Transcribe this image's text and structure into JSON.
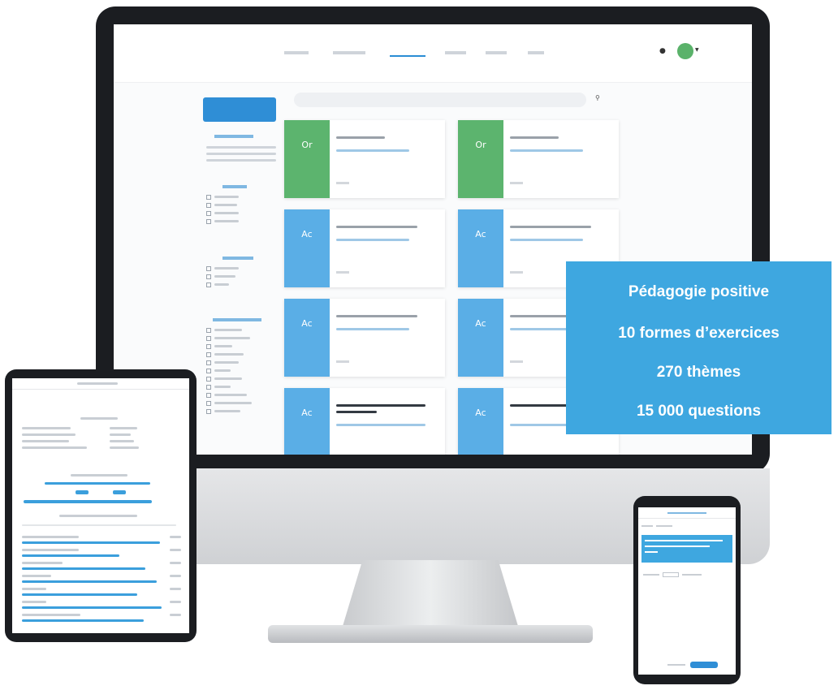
{
  "promo": {
    "lines": [
      "Pédagogie positive",
      "10 formes d’exercices",
      "270 thèmes",
      "15 000 questions"
    ]
  },
  "colors": {
    "brand_blue": "#3ea7e0",
    "card_green": "#5cb46e",
    "card_blue": "#5aaee6",
    "device_frame": "#1b1d21"
  },
  "desktop": {
    "cards": [
      {
        "abbr": "Or",
        "color": "green"
      },
      {
        "abbr": "Or",
        "color": "green"
      },
      {
        "abbr": "Ac",
        "color": "blue"
      },
      {
        "abbr": "Ac",
        "color": "blue"
      },
      {
        "abbr": "Ac",
        "color": "blue"
      },
      {
        "abbr": "Ac",
        "color": "blue"
      },
      {
        "abbr": "Ac",
        "color": "blue"
      },
      {
        "abbr": "Ac",
        "color": "blue"
      }
    ],
    "icons": [
      "search-icon",
      "user-icon",
      "avatar",
      "chevron-down-icon"
    ]
  }
}
